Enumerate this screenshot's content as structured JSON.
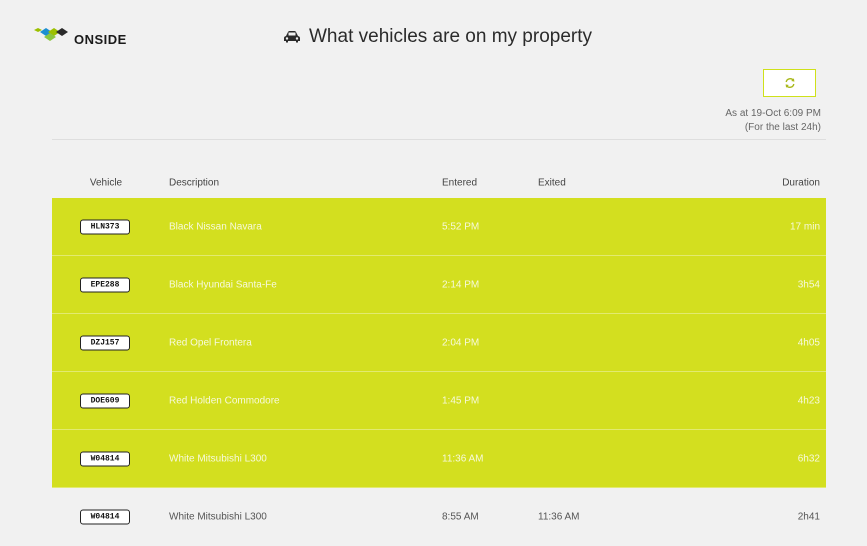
{
  "brand": {
    "logo_text": "ONSIDE"
  },
  "header": {
    "title": "What vehicles are on my property",
    "title_icon": "car-icon"
  },
  "refresh": {
    "icon": "refresh-icon",
    "accent_color": "#d3df1f"
  },
  "status": {
    "as_at": "As at 19-Oct 6:09 PM",
    "period": "(For the last 24h)"
  },
  "table": {
    "columns": [
      "Vehicle",
      "Description",
      "Entered",
      "Exited",
      "Duration"
    ],
    "rows": [
      {
        "plate": "HLN373",
        "description": "Black Nissan Navara",
        "entered": "5:52 PM",
        "exited": "",
        "duration": "17 min",
        "on_property": true
      },
      {
        "plate": "EPE288",
        "description": "Black Hyundai Santa-Fe",
        "entered": "2:14 PM",
        "exited": "",
        "duration": "3h54",
        "on_property": true
      },
      {
        "plate": "DZJ157",
        "description": "Red Opel Frontera",
        "entered": "2:04 PM",
        "exited": "",
        "duration": "4h05",
        "on_property": true
      },
      {
        "plate": "DOE609",
        "description": "Red Holden Commodore",
        "entered": "1:45 PM",
        "exited": "",
        "duration": "4h23",
        "on_property": true
      },
      {
        "plate": "W04814",
        "description": "White Mitsubishi L300",
        "entered": "11:36 AM",
        "exited": "",
        "duration": "6h32",
        "on_property": true
      },
      {
        "plate": "W04814",
        "description": "White Mitsubishi L300",
        "entered": "8:55 AM",
        "exited": "11:36 AM",
        "duration": "2h41",
        "on_property": false
      }
    ]
  },
  "colors": {
    "highlight": "#d3df1f",
    "background": "#f1f1f1"
  }
}
